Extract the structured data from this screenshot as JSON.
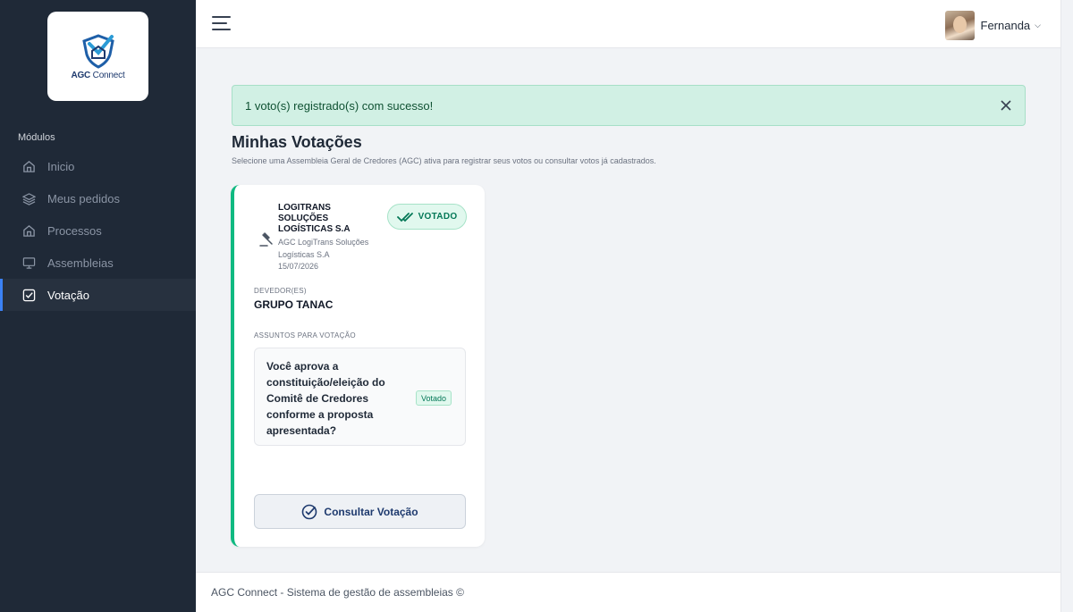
{
  "sidebar": {
    "logo": {
      "brand": "AGC",
      "suffix": "Connect"
    },
    "section_title": "Módulos",
    "items": [
      {
        "label": "Inicio",
        "icon": "home-icon",
        "active": false
      },
      {
        "label": "Meus pedidos",
        "icon": "layers-icon",
        "active": false
      },
      {
        "label": "Processos",
        "icon": "home-icon",
        "active": false
      },
      {
        "label": "Assembleias",
        "icon": "monitor-icon",
        "active": false
      },
      {
        "label": "Votação",
        "icon": "checkbox-icon",
        "active": true
      }
    ]
  },
  "topbar": {
    "user_name": "Fernanda"
  },
  "alert": {
    "message": "1 voto(s) registrado(s) com sucesso!"
  },
  "page": {
    "title": "Minhas Votações",
    "subtitle": "Selecione uma Assembleia Geral de Credores (AGC) ativa para registrar seus votos ou consultar votos já cadastrados."
  },
  "card": {
    "company": "LOGITRANS SOLUÇÕES LOGÍSTICAS S.A",
    "company_sub": "AGC LogiTrans Soluções Logísticas S.A",
    "date": "15/07/2026",
    "status_badge": "VOTADO",
    "debtor_label": "DEVEDOR(ES)",
    "debtor_name": "GRUPO TANAC",
    "topics_label": "ASSUNTOS PARA VOTAÇÃO",
    "topic_text": "Você aprova a constituição/eleição do Comitê de Credores conforme a proposta apresentada?",
    "topic_status": "Votado",
    "button_label": "Consultar Votação"
  },
  "footer": {
    "text": "AGC Connect - Sistema de gestão de assembleias ©"
  },
  "colors": {
    "sidebar_bg": "#1f2937",
    "accent_green": "#10b981",
    "accent_blue": "#3b82f6",
    "alert_bg": "#d1f0e4"
  }
}
